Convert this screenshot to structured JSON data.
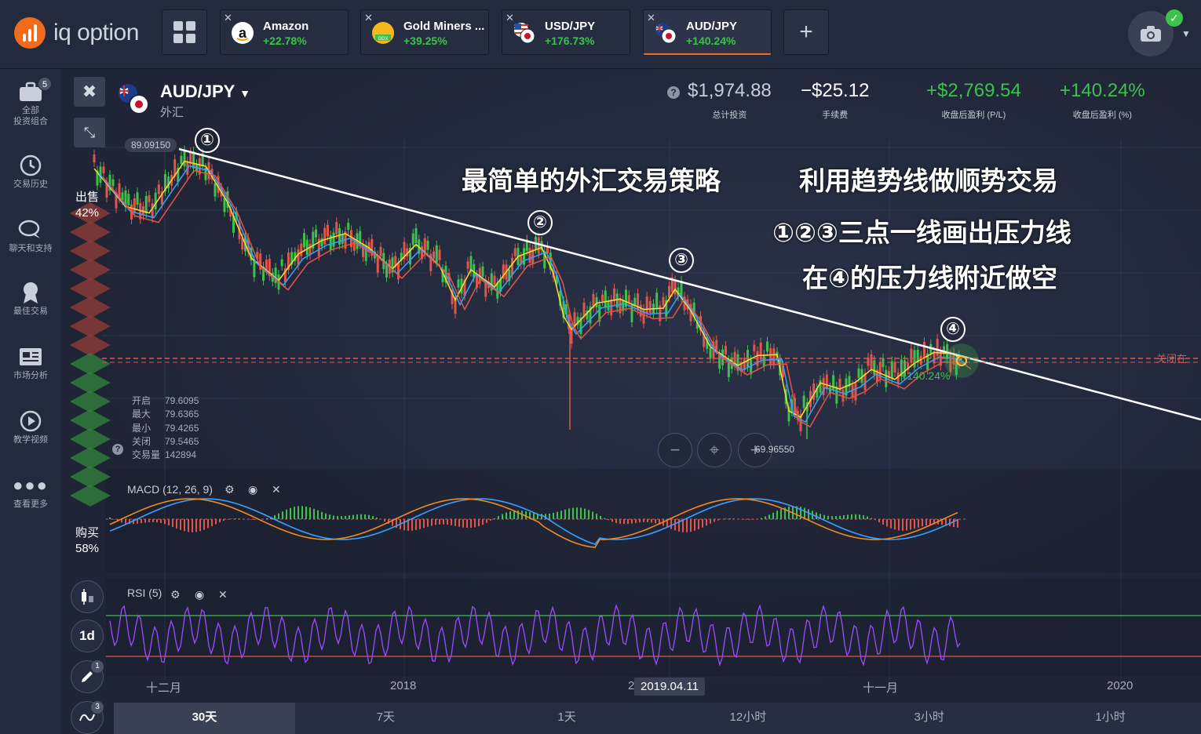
{
  "logo": {
    "text": "iq option"
  },
  "tabs": [
    {
      "name": "Amazon",
      "pct": "+22.78%",
      "icon": "amazon-icon"
    },
    {
      "name": "Gold Miners ...",
      "pct": "+39.25%",
      "icon": "gdx-icon"
    },
    {
      "name": "USD/JPY",
      "pct": "+176.73%",
      "icon": "us-jp-flag-icon"
    },
    {
      "name": "AUD/JPY",
      "pct": "+140.24%",
      "icon": "au-jp-flag-icon",
      "active": true
    }
  ],
  "sidebar": {
    "items": [
      {
        "label1": "全部",
        "label2": "投资组合",
        "badge": "5"
      },
      {
        "label1": "交易历史"
      },
      {
        "label1": "聊天和支持"
      },
      {
        "label1": "最佳交易"
      },
      {
        "label1": "市场分析"
      },
      {
        "label1": "教学视频"
      },
      {
        "label1": "查看更多"
      }
    ]
  },
  "asset": {
    "title": "AUD/JPY",
    "subtitle": "外汇"
  },
  "stats": [
    {
      "value": "$1,974.88",
      "label": "总计投资",
      "color": "#c8ccd6"
    },
    {
      "value": "−$25.12",
      "label": "手续费",
      "color": "#ffffff"
    },
    {
      "value": "+$2,769.54",
      "label": "收盘后盈利 (P/L)",
      "color": "#3cc24a"
    },
    {
      "value": "+140.24%",
      "label": "收盘后盈利 (%)",
      "color": "#3cc24a"
    }
  ],
  "headlines": {
    "h1": "最简单的外汇交易策略",
    "h2": "利用趋势线做顺势交易",
    "h3": "①②③三点一线画出压力线",
    "h4": "在④的压力线附近做空"
  },
  "markers": [
    "①",
    "②",
    "③",
    "④"
  ],
  "sentiment": {
    "sell_label": "出售",
    "sell_pct": "42%",
    "buy_label": "购买",
    "buy_pct": "58%"
  },
  "ohlc": {
    "open_label": "开启",
    "open": "79.6095",
    "high_label": "最大",
    "high": "79.6365",
    "low_label": "最小",
    "low": "79.4265",
    "close_label": "关闭",
    "close": "79.5465",
    "volume_label": "交易量",
    "volume": "142894"
  },
  "price_tag": "89.09150",
  "low_tag": "69.96550",
  "close_label": "关闭在",
  "pl_label": "+140.24%",
  "indicators": {
    "macd": "MACD (12, 26, 9)",
    "rsi": "RSI (5)"
  },
  "time_axis": {
    "t1": "十二月",
    "t2": "2018",
    "t3": "2",
    "t4": "十一月",
    "t5": "2020",
    "current_date": "2019.04.11"
  },
  "left_tools": {
    "period": "1d",
    "draw_badge": "1",
    "ind_badge": "3"
  },
  "timeframes": [
    "30天",
    "7天",
    "1天",
    "12小时",
    "3小时",
    "1小时"
  ],
  "colors": {
    "accent": "#f26b1d",
    "up": "#3cc24a",
    "down": "#e0564a",
    "rsi": "#9b4dff"
  }
}
